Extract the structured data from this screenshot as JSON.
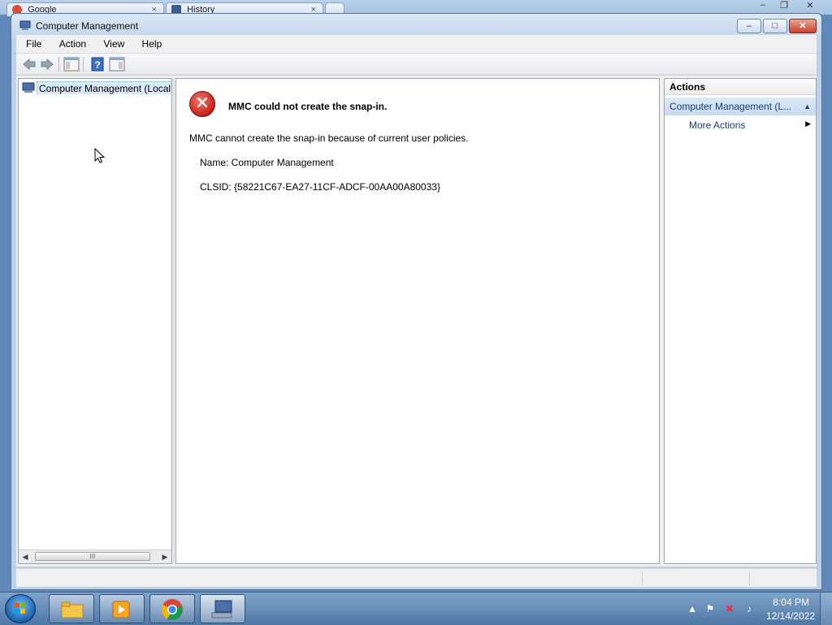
{
  "browser": {
    "tabs": [
      {
        "label": "Google"
      },
      {
        "label": "History"
      }
    ]
  },
  "window": {
    "title": "Computer Management",
    "controls": {
      "minimize": "–",
      "maximize": "□",
      "close": "✕"
    }
  },
  "menu": {
    "items": [
      "File",
      "Action",
      "View",
      "Help"
    ]
  },
  "tree": {
    "root_label": "Computer Management (Local"
  },
  "error": {
    "title": "MMC could not create the snap-in.",
    "message": "MMC cannot create the snap-in because of current user policies.",
    "name_line": "Name: Computer Management",
    "clsid_line": "CLSID: {58221C67-EA27-11CF-ADCF-00AA00A80033}",
    "icon_glyph": "✕"
  },
  "actions": {
    "header": "Actions",
    "section_label": "Computer Management (L...",
    "items": [
      {
        "label": "More Actions"
      }
    ]
  },
  "scrollbar": {
    "grip": "III"
  },
  "taskbar": {
    "time": "8:04 PM",
    "date": "12/14/2022"
  },
  "colors": {
    "error_red": "#c8201a",
    "action_link": "#1a3f73",
    "selection": "#dbe8f7"
  }
}
